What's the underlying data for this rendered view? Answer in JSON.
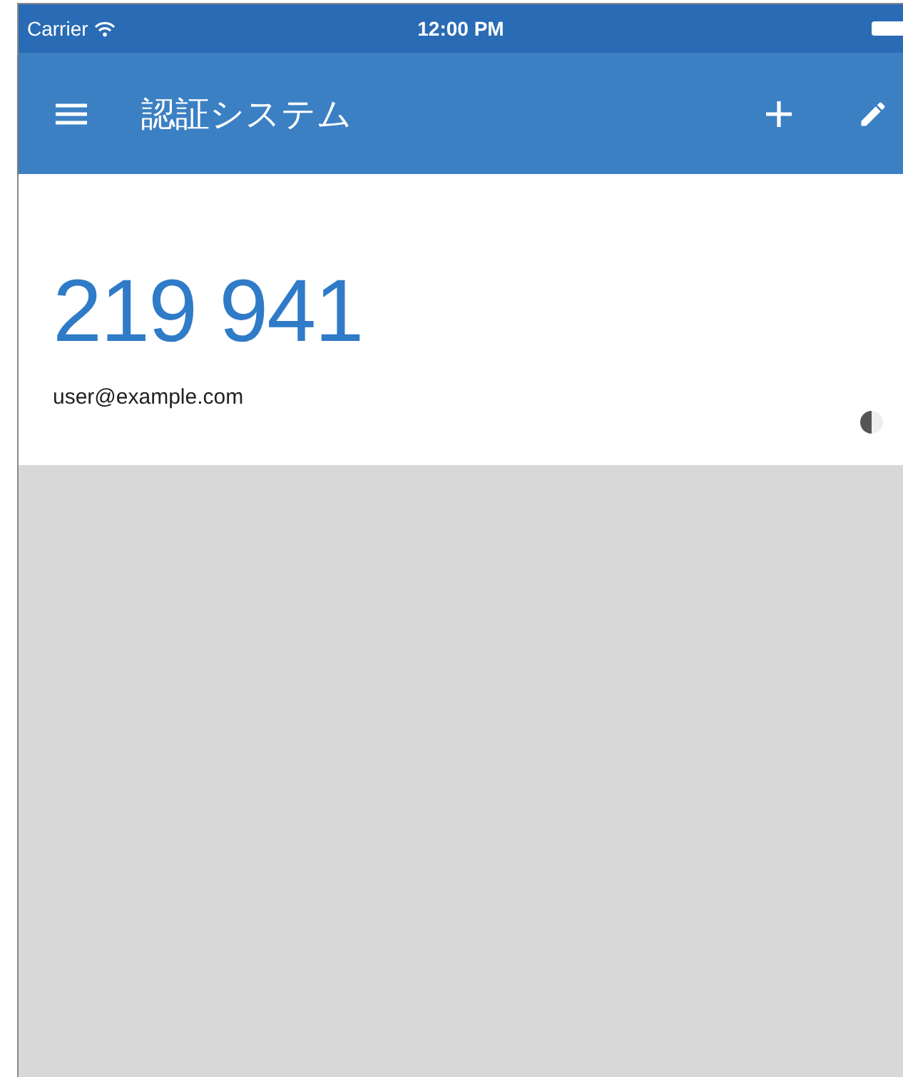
{
  "status_bar": {
    "carrier": "Carrier",
    "time": "12:00 PM"
  },
  "app_bar": {
    "title": "認証システム"
  },
  "accounts": [
    {
      "code": "219 941",
      "account": "user@example.com",
      "level": 0.5
    }
  ]
}
